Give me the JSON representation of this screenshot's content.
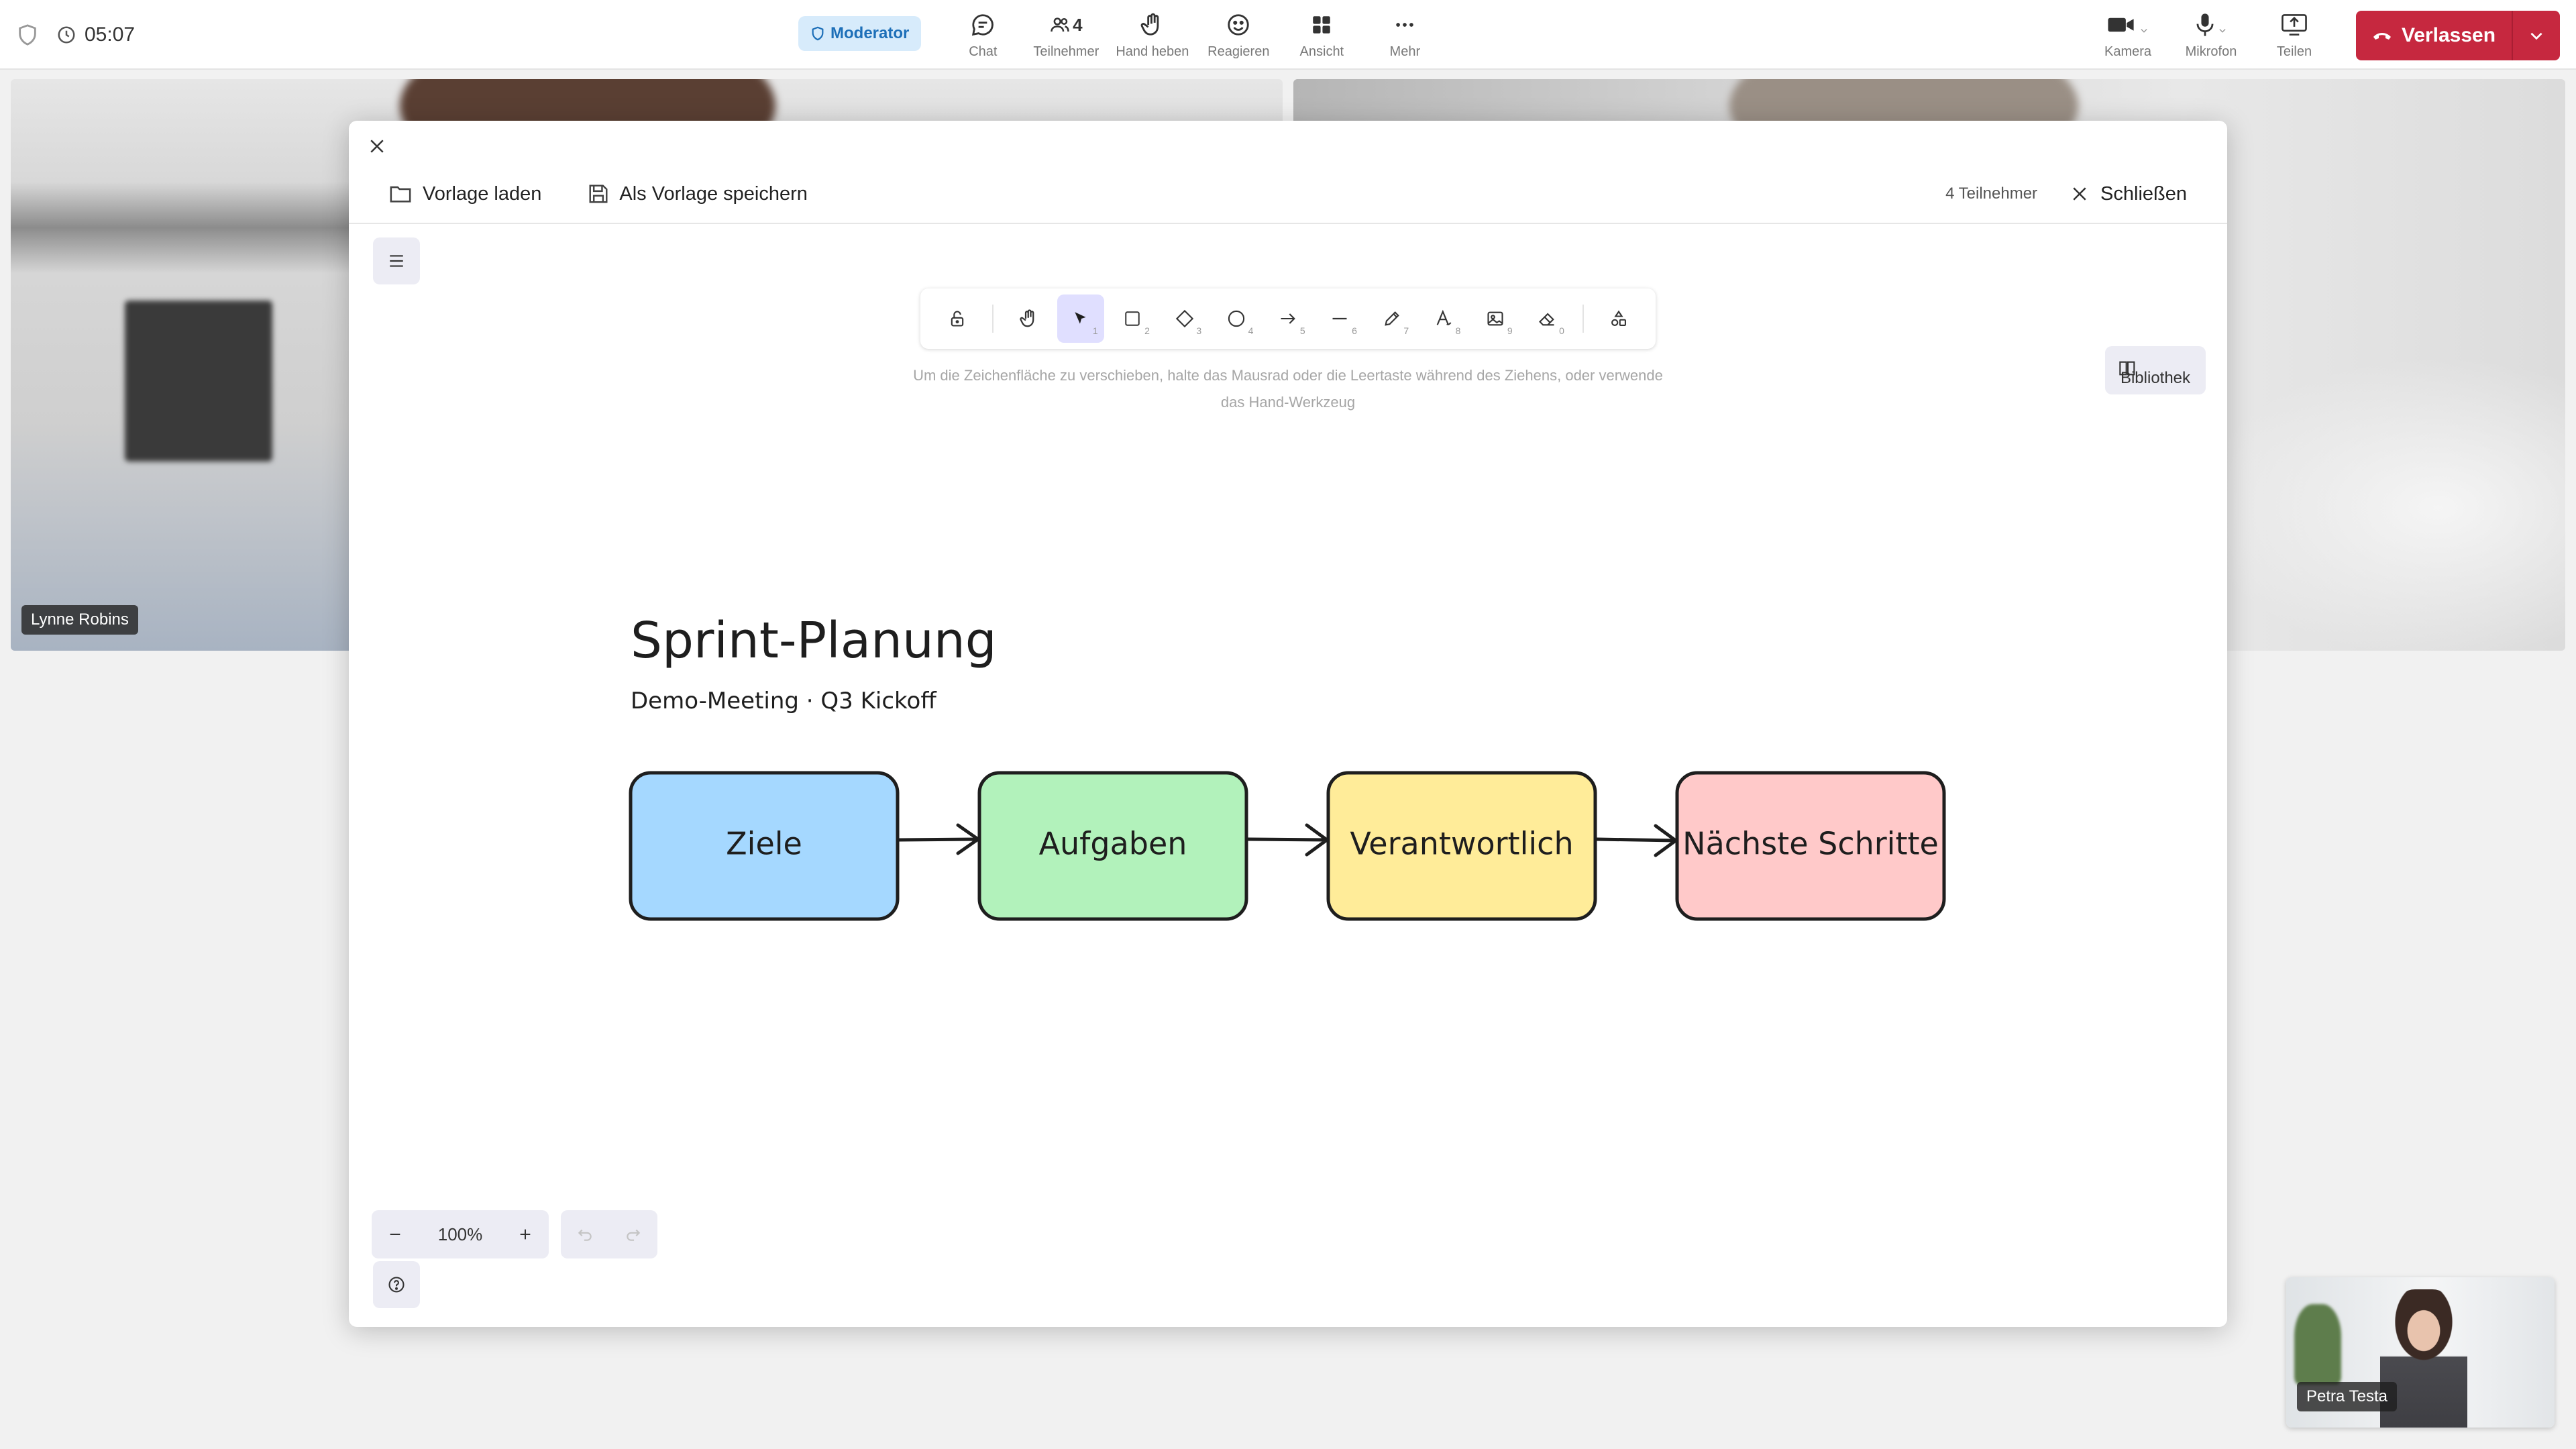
{
  "topbar": {
    "timer": "05:07",
    "moderator_badge": "Moderator",
    "buttons": {
      "chat": "Chat",
      "participants": "Teilnehmer",
      "participants_count": "4",
      "raise_hand": "Hand heben",
      "react": "Reagieren",
      "view": "Ansicht",
      "more": "Mehr",
      "camera": "Kamera",
      "microphone": "Mikrofon",
      "share": "Teilen"
    },
    "leave_label": "Verlassen"
  },
  "tiles": {
    "participant_1": "Lynne Robins",
    "self": "Petra Testa"
  },
  "whiteboard": {
    "load_template": "Vorlage laden",
    "save_template": "Als Vorlage speichern",
    "participant_count": "4 Teilnehmer",
    "close_label": "Schließen",
    "hint": "Um die Zeichenfläche zu verschieben, halte das Mausrad oder die Leertaste während des Ziehens, oder verwende das Hand-Werkzeug",
    "library_label": "Bibliothek",
    "zoom": "100%",
    "tools": [
      {
        "name": "lock",
        "icon": "lock-icon",
        "num": ""
      },
      {
        "name": "hand",
        "icon": "hand-icon",
        "num": ""
      },
      {
        "name": "select",
        "icon": "pointer-icon",
        "num": "1"
      },
      {
        "name": "rectangle",
        "icon": "rectangle-icon",
        "num": "2"
      },
      {
        "name": "diamond",
        "icon": "diamond-icon",
        "num": "3"
      },
      {
        "name": "ellipse",
        "icon": "circle-icon",
        "num": "4"
      },
      {
        "name": "arrow",
        "icon": "arrow-icon",
        "num": "5"
      },
      {
        "name": "line",
        "icon": "line-icon",
        "num": "6"
      },
      {
        "name": "draw",
        "icon": "pencil-icon",
        "num": "7"
      },
      {
        "name": "text",
        "icon": "text-icon",
        "num": "8"
      },
      {
        "name": "image",
        "icon": "image-icon",
        "num": "9"
      },
      {
        "name": "eraser",
        "icon": "eraser-icon",
        "num": "0"
      },
      {
        "name": "extra-tools",
        "icon": "shapes-icon",
        "num": ""
      }
    ],
    "drawing": {
      "title": "Sprint-Planung",
      "subtitle": "Demo-Meeting · Q3 Kickoff",
      "boxes": [
        {
          "label": "Ziele",
          "color": "#a5d8ff"
        },
        {
          "label": "Aufgaben",
          "color": "#b2f2bb"
        },
        {
          "label": "Verantwortlich",
          "color": "#ffec99"
        },
        {
          "label": "Nächste Schritte",
          "color": "#ffc9c9"
        }
      ]
    }
  },
  "colors": {
    "leave": "#c6283f",
    "moderator_bg": "#d7ebfb",
    "moderator_text": "#1d6fb8",
    "active_tool": "#e0dfff"
  }
}
